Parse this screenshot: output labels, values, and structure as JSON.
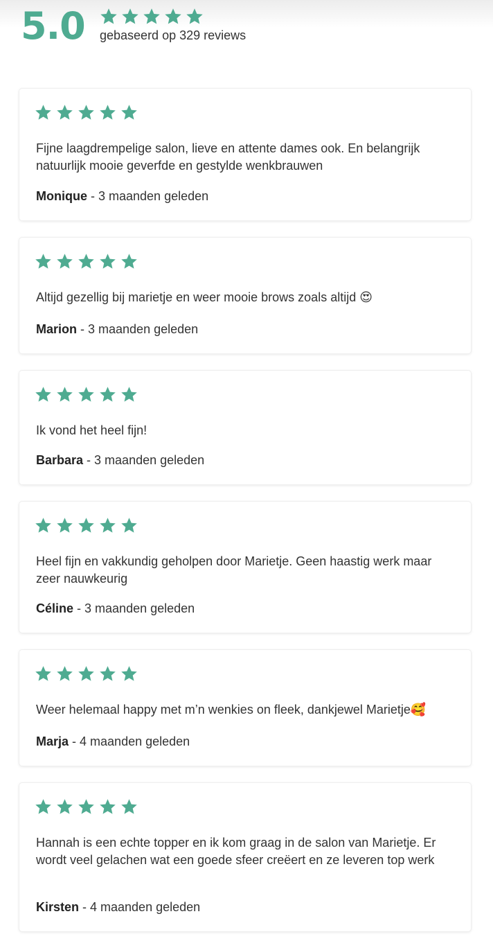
{
  "summary": {
    "score": "5.0",
    "rating_stars": 5,
    "based_on_text": "gebaseerd op 329 reviews"
  },
  "colors": {
    "accent": "#4fab91"
  },
  "icons": {
    "star": "star-icon"
  },
  "reviews": [
    {
      "rating": 5,
      "text": "Fijne laagdrempelige salon, lieve en attente dames ook. En belangrijk natuurlijk mooie geverfde en gestylde wenkbrauwen",
      "author": "Monique",
      "time": " - 3 maanden geleden"
    },
    {
      "rating": 5,
      "text": "Altijd gezellig bij marietje en weer mooie brows zoals altijd 😍",
      "author": "Marion",
      "time": " - 3 maanden geleden"
    },
    {
      "rating": 5,
      "text": "Ik vond het heel fijn!",
      "author": "Barbara",
      "time": " - 3 maanden geleden"
    },
    {
      "rating": 5,
      "text": "Heel fijn en vakkundig geholpen door Marietje. Geen haastig werk maar zeer nauwkeurig",
      "author": "Céline",
      "time": " - 3 maanden geleden"
    },
    {
      "rating": 5,
      "text": "Weer helemaal happy met m’n wenkies on fleek, dankjewel Marietje🥰",
      "author": "Marja",
      "time": " - 4 maanden geleden"
    },
    {
      "rating": 5,
      "text": "Hannah is een echte topper en ik kom graag in de salon van Marietje. Er wordt veel gelachen wat een goede sfeer creëert en ze leveren top werk",
      "author": "Kirsten",
      "time": " - 4 maanden geleden"
    }
  ]
}
